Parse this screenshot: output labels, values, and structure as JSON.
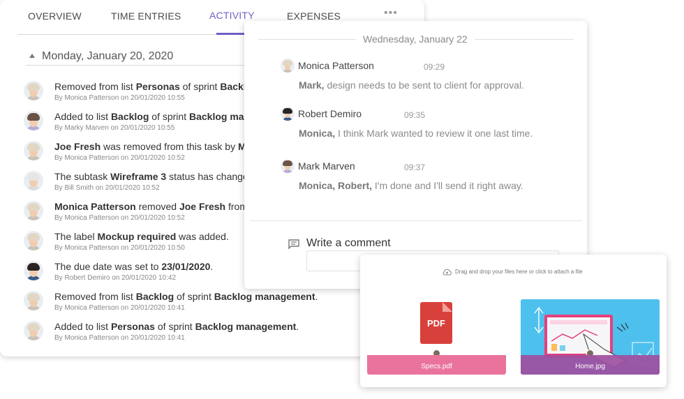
{
  "tabs": [
    {
      "label": "OVERVIEW",
      "active": false
    },
    {
      "label": "TIME ENTRIES",
      "active": false
    },
    {
      "label": "ACTIVITY",
      "active": true
    },
    {
      "label": "EXPENSES",
      "active": false
    }
  ],
  "tabs_more_icon": "more-horizontal-icon",
  "accent_color": "#6f5fc6",
  "day_header": "Monday, January 20, 2020",
  "activity": [
    {
      "segments": [
        {
          "t": "Removed from list "
        },
        {
          "t": "Personas",
          "b": true
        },
        {
          "t": " of sprint "
        },
        {
          "t": "Backlog management.",
          "b": true
        }
      ],
      "meta": "By Monica Patterson on 20/01/2020 10:55",
      "avatar": "monica"
    },
    {
      "segments": [
        {
          "t": "Added to list "
        },
        {
          "t": "Backlog",
          "b": true
        },
        {
          "t": " of sprint "
        },
        {
          "t": "Backlog management.",
          "b": true
        }
      ],
      "meta": "By Marky Marven on 20/01/2020 10:55",
      "avatar": "mark"
    },
    {
      "segments": [
        {
          "t": "Joe Fresh",
          "b": true
        },
        {
          "t": " was removed from this task by "
        },
        {
          "t": "Monica Patterson.",
          "b": true
        }
      ],
      "meta": "By Monica Patterson on 20/01/2020 10:52",
      "avatar": "monica"
    },
    {
      "segments": [
        {
          "t": "The subtask "
        },
        {
          "t": "Wireframe 3",
          "b": true
        },
        {
          "t": " status has changed to Done."
        }
      ],
      "meta": "By Bill Smith on 20/01/2020 10:52",
      "avatar": "bill"
    },
    {
      "segments": [
        {
          "t": "Monica Patterson",
          "b": true
        },
        {
          "t": " removed "
        },
        {
          "t": "Joe Fresh",
          "b": true
        },
        {
          "t": " from this task."
        }
      ],
      "meta": "By Monica Patterson on 20/01/2020 10:52",
      "avatar": "monica"
    },
    {
      "segments": [
        {
          "t": "The label "
        },
        {
          "t": "Mockup required",
          "b": true
        },
        {
          "t": " was added."
        }
      ],
      "meta": "By Monica Patterson on 20/01/2020 10:50",
      "avatar": "monica"
    },
    {
      "segments": [
        {
          "t": "The due date was set to "
        },
        {
          "t": "23/01/2020",
          "b": true
        },
        {
          "t": "."
        }
      ],
      "meta": "By Robert Demiro on 20/01/2020 10:42",
      "avatar": "robert"
    },
    {
      "segments": [
        {
          "t": "Removed from list "
        },
        {
          "t": "Backlog",
          "b": true
        },
        {
          "t": " of sprint "
        },
        {
          "t": "Backlog management",
          "b": true
        },
        {
          "t": "."
        }
      ],
      "meta": "By Monica Patterson on 20/01/2020 10:41",
      "avatar": "monica"
    },
    {
      "segments": [
        {
          "t": "Added to list "
        },
        {
          "t": "Personas",
          "b": true
        },
        {
          "t": " of sprint "
        },
        {
          "t": "Backlog management",
          "b": true
        },
        {
          "t": "."
        }
      ],
      "meta": "By Monica Patterson on 20/01/2020 10:41",
      "avatar": "monica"
    }
  ],
  "comments_date": "Wednesday, January 22",
  "comments": [
    {
      "name": "Monica Patterson",
      "time": "09:29",
      "mention": "Mark,",
      "text": " design needs to be sent to client for approval.",
      "avatar": "monica"
    },
    {
      "name": "Robert Demiro",
      "time": "09:35",
      "mention": "Monica,",
      "text": " I think Mark wanted to review it one last time.",
      "avatar": "robert"
    },
    {
      "name": "Mark Marven",
      "time": "09:37",
      "mention": "Monica, Robert,",
      "text": " I'm done and I'll send it right away.",
      "avatar": "mark"
    }
  ],
  "write_comment_label": "Write a comment",
  "upload_hint": "Drag and drop your files here or click to attach a file",
  "files": [
    {
      "name": "Specs.pdf",
      "type": "pdf",
      "icon_label": "PDF"
    },
    {
      "name": "Home.jpg",
      "type": "image"
    }
  ],
  "avatar_styles": {
    "monica": {
      "hair": "#e2d7c4",
      "body": "#c9c3b8"
    },
    "mark": {
      "hair": "#6a5346",
      "body": "#b7acd6"
    },
    "bill": {
      "hair": "#e6e6e6",
      "body": "#dcdcdc"
    },
    "robert": {
      "hair": "#2a2322",
      "body": "#3d5a8a"
    }
  }
}
